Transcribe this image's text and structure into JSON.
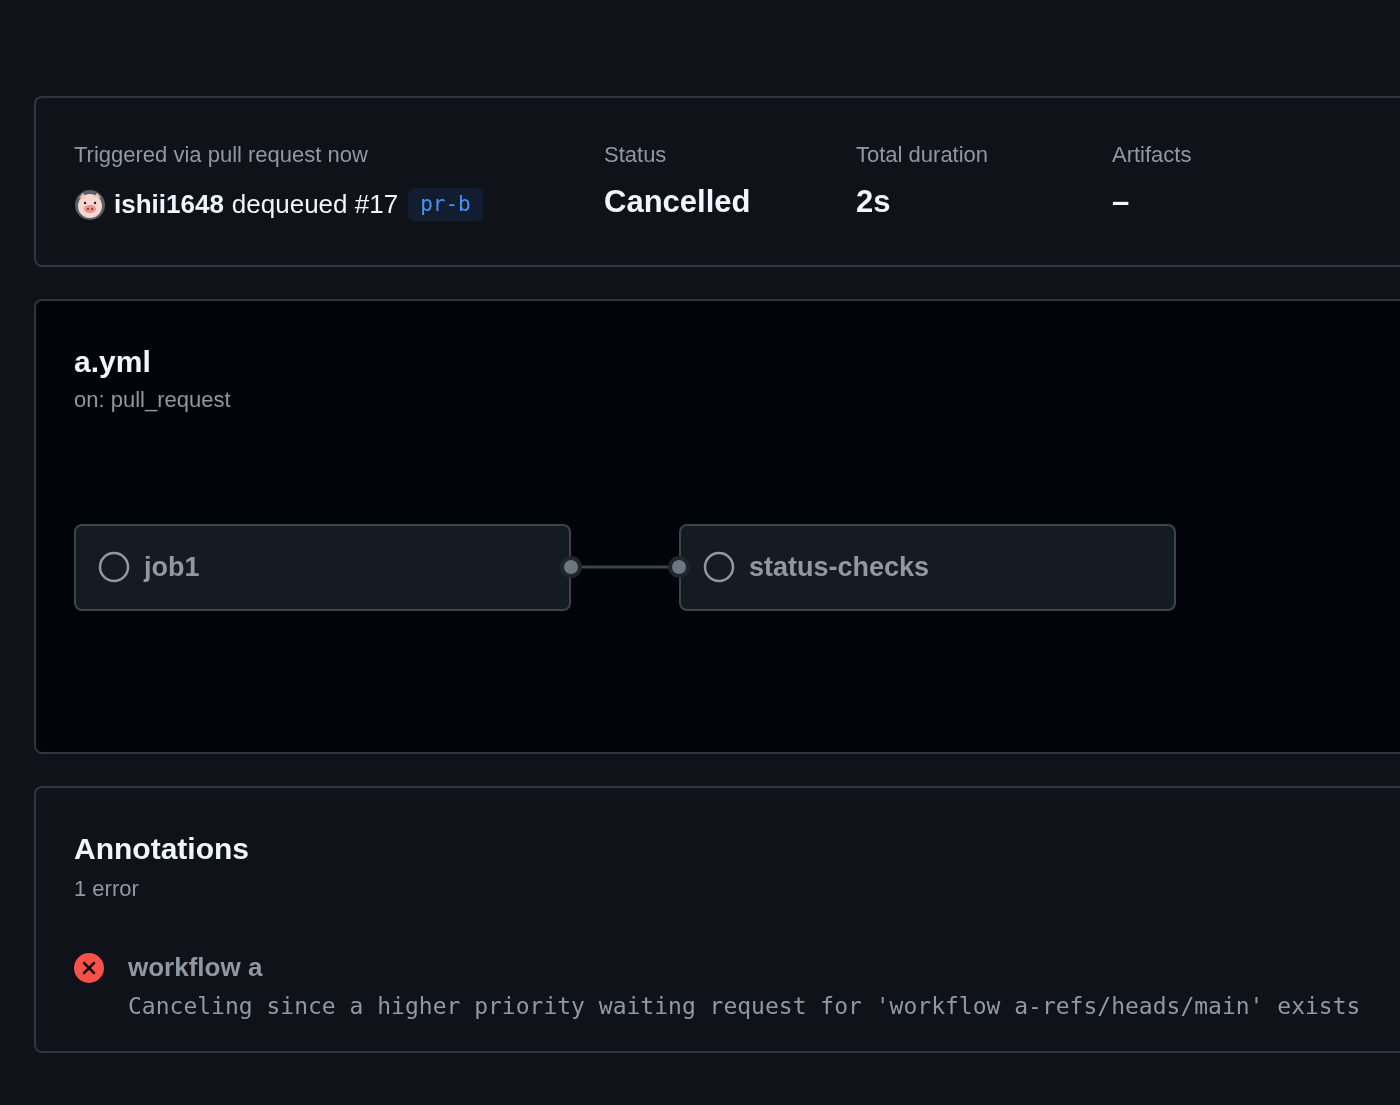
{
  "summary": {
    "trigger": "Triggered via pull request now",
    "actor": "ishii1648",
    "action": "dequeued #17",
    "branch": "pr-b",
    "stats": [
      {
        "label": "Status",
        "value": "Cancelled"
      },
      {
        "label": "Total duration",
        "value": "2s"
      },
      {
        "label": "Artifacts",
        "value": "–"
      }
    ]
  },
  "workflow": {
    "name": "a.yml",
    "event": "on: pull_request",
    "jobs": [
      {
        "name": "job1"
      },
      {
        "name": "status-checks"
      }
    ]
  },
  "annotations": {
    "title": "Annotations",
    "count": "1 error",
    "items": [
      {
        "kind": "error",
        "title": "workflow a",
        "message": "Canceling since a higher priority waiting request for 'workflow a-refs/heads/main' exists"
      }
    ]
  }
}
